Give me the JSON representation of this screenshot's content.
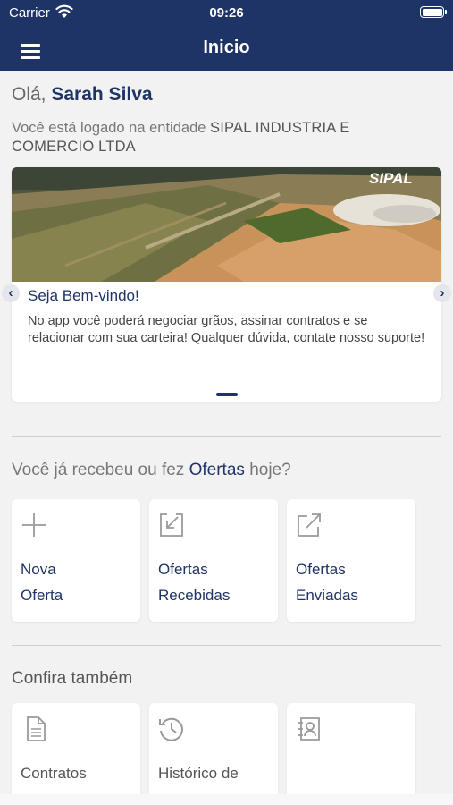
{
  "status_bar": {
    "carrier": "Carrier",
    "time": "09:26"
  },
  "header": {
    "title": "Inicio"
  },
  "greeting": {
    "prefix": "Olá,",
    "name": "Sarah Silva"
  },
  "entity": {
    "prefix": "Você está logado na entidade",
    "name": "SIPAL INDUSTRIA E COMERCIO LTDA"
  },
  "carousel": {
    "brand": "SIPAL",
    "title": "Seja Bem-vindo!",
    "text": "No app você poderá negociar grãos, assinar contratos e se relacionar com sua carteira! Qualquer dúvida, contate nosso suporte!"
  },
  "offers": {
    "question_prefix": "Você já recebeu ou fez",
    "question_highlight": "Ofertas",
    "question_suffix": "hoje?",
    "tiles": [
      {
        "line1": "Nova",
        "line2": "Oferta",
        "icon": "plus-icon"
      },
      {
        "line1": "Ofertas",
        "line2": "Recebidas",
        "icon": "arrow-in-box-icon"
      },
      {
        "line1": "Ofertas",
        "line2": "Enviadas",
        "icon": "arrow-out-box-icon"
      }
    ]
  },
  "also": {
    "title": "Confira também",
    "tiles": [
      {
        "label": "Contratos",
        "icon": "document-icon"
      },
      {
        "label": "Histórico de",
        "icon": "history-icon"
      },
      {
        "label": "",
        "icon": "contact-card-icon"
      }
    ]
  },
  "colors": {
    "primary": "#1f3466",
    "background": "#f2f2f2"
  }
}
